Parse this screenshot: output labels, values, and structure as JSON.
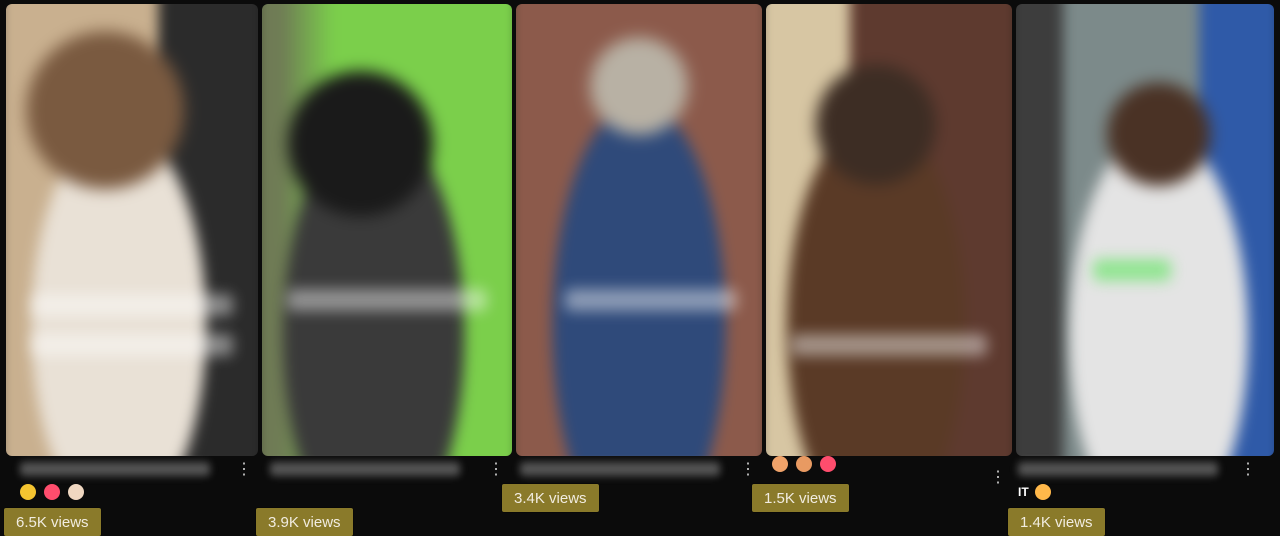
{
  "shelf": {
    "videos": [
      {
        "views": "6.5K views",
        "emoji_row": [
          "grinning-face",
          "heart-eyes-face",
          "thumbs-up"
        ],
        "accent": "#b7a48a"
      },
      {
        "views": "3.9K views",
        "emoji_row": [],
        "accent": "#8a8a6a"
      },
      {
        "views": "3.4K views",
        "emoji_row": [],
        "accent": "#4b5a7a"
      },
      {
        "views": "1.5K views",
        "emoji_row": [
          "face-1",
          "face-2",
          "face-3"
        ],
        "accent": "#6b4a2a"
      },
      {
        "views": "1.4K views",
        "emoji_prefix": "IT",
        "emoji_row": [
          "flushed-face"
        ],
        "accent": "#c9c9c9"
      }
    ]
  },
  "colors": {
    "views_badge": "#8a7a2a",
    "views_text": "#f1ece0",
    "background": "#0b0b0b"
  }
}
